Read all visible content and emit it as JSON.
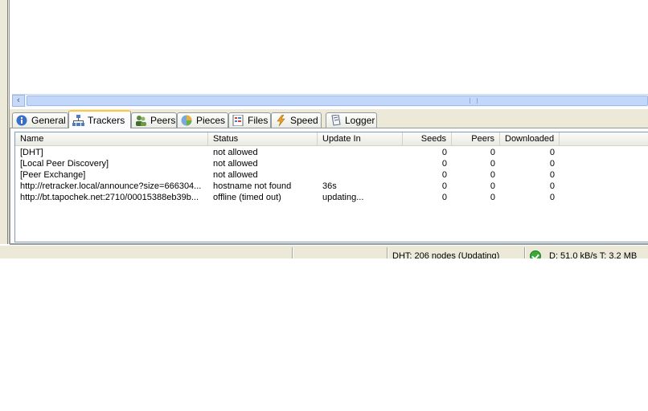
{
  "tabs": [
    {
      "label": "General",
      "icon": "info-icon",
      "active": false
    },
    {
      "label": "Trackers",
      "icon": "network-icon",
      "active": true
    },
    {
      "label": "Peers",
      "icon": "users-icon",
      "active": false
    },
    {
      "label": "Pieces",
      "icon": "pie-icon",
      "active": false
    },
    {
      "label": "Files",
      "icon": "files-icon",
      "active": false
    },
    {
      "label": "Speed",
      "icon": "lightning-icon",
      "active": false
    },
    {
      "label": "Logger",
      "icon": "document-icon",
      "active": false
    }
  ],
  "trackers": {
    "columns": {
      "name": "Name",
      "status": "Status",
      "update_in": "Update In",
      "seeds": "Seeds",
      "peers": "Peers",
      "downloaded": "Downloaded"
    },
    "rows": [
      {
        "name": "[DHT]",
        "status": "not allowed",
        "update_in": "",
        "seeds": "0",
        "peers": "0",
        "downloaded": "0"
      },
      {
        "name": "[Local Peer Discovery]",
        "status": "not allowed",
        "update_in": "",
        "seeds": "0",
        "peers": "0",
        "downloaded": "0"
      },
      {
        "name": "[Peer Exchange]",
        "status": "not allowed",
        "update_in": "",
        "seeds": "0",
        "peers": "0",
        "downloaded": "0"
      },
      {
        "name": "http://retracker.local/announce?size=666304...",
        "status": "hostname not found",
        "update_in": "36s",
        "seeds": "0",
        "peers": "0",
        "downloaded": "0"
      },
      {
        "name": "http://bt.tapochek.net:2710/00015388eb39b...",
        "status": "offline (timed out)",
        "update_in": "updating...",
        "seeds": "0",
        "peers": "0",
        "downloaded": "0"
      }
    ]
  },
  "statusbar": {
    "dht": "DHT: 206 nodes (Updating)",
    "transfer": "D: 51.0 kB/s T: 3.2 MB"
  }
}
